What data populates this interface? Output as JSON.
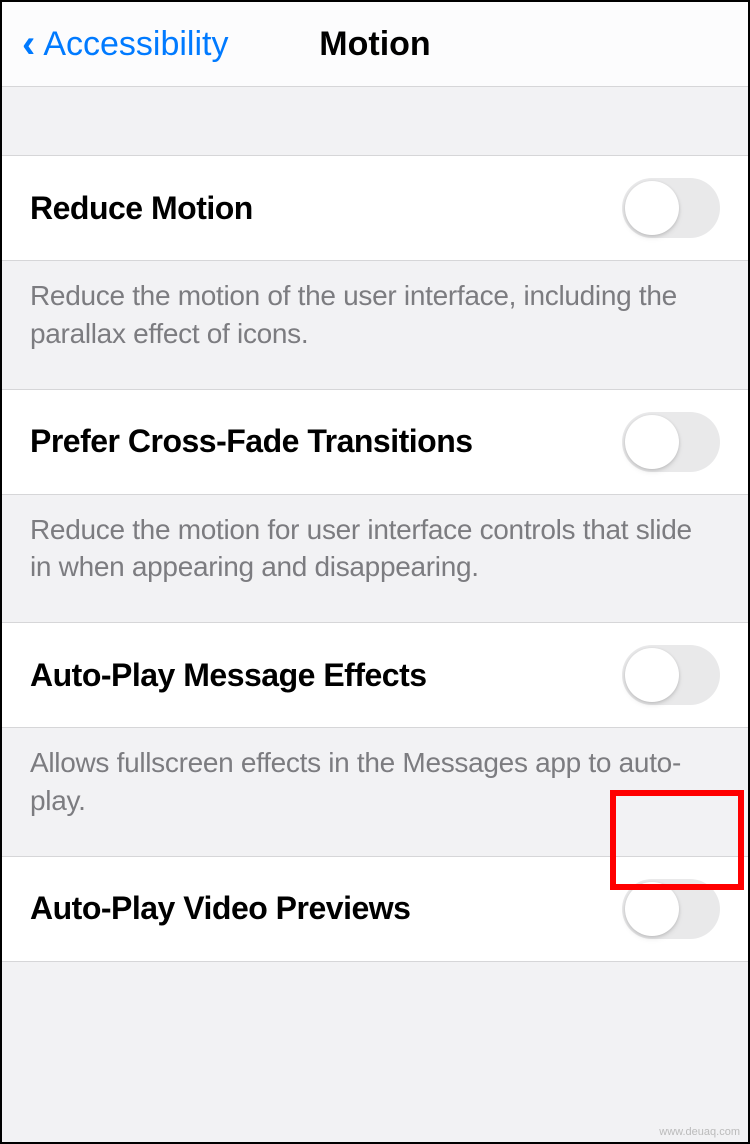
{
  "navbar": {
    "back_label": "Accessibility",
    "title": "Motion"
  },
  "settings": {
    "reduce_motion": {
      "label": "Reduce Motion",
      "footer": "Reduce the motion of the user interface, including the parallax effect of icons.",
      "on": false
    },
    "prefer_cross_fade": {
      "label": "Prefer Cross-Fade Transitions",
      "footer": "Reduce the motion for user interface controls that slide in when appearing and disappearing.",
      "on": false
    },
    "autoplay_message_effects": {
      "label": "Auto-Play Message Effects",
      "footer": "Allows fullscreen effects in the Messages app to auto-play.",
      "on": false
    },
    "autoplay_video_previews": {
      "label": "Auto-Play Video Previews",
      "on": false
    }
  },
  "watermark": "www.deuaq.com"
}
